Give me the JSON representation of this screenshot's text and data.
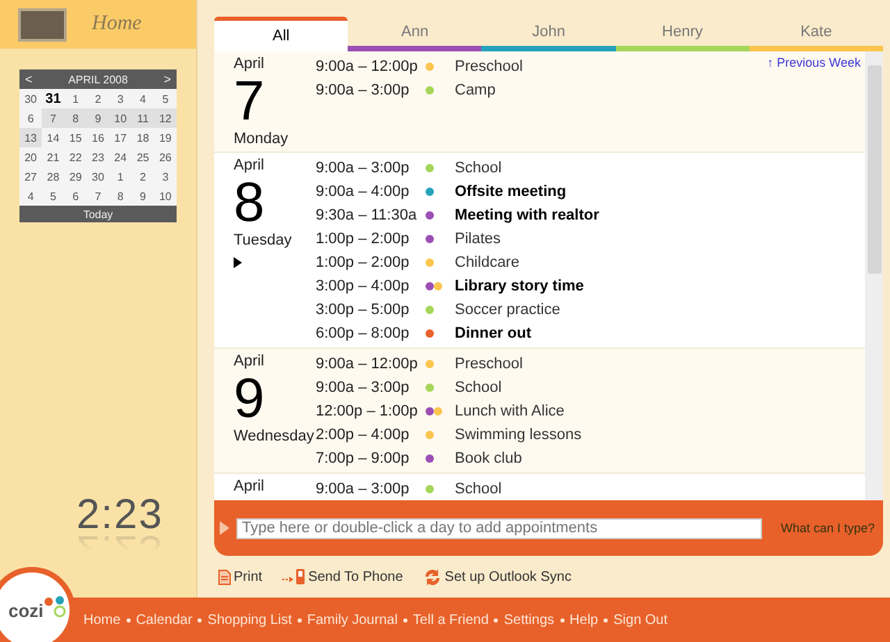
{
  "header": {
    "title": "Home"
  },
  "mini_calendar": {
    "prev": "<",
    "month": "APRIL 2008",
    "next": ">",
    "today_button": "Today",
    "weeks": [
      [
        {
          "label": "30",
          "selected": false,
          "today": false
        },
        {
          "label": "31",
          "selected": false,
          "today": true
        },
        {
          "label": "1",
          "selected": false,
          "today": false
        },
        {
          "label": "2",
          "selected": false,
          "today": false
        },
        {
          "label": "3",
          "selected": false,
          "today": false
        },
        {
          "label": "4",
          "selected": false,
          "today": false
        },
        {
          "label": "5",
          "selected": false,
          "today": false
        }
      ],
      [
        {
          "label": "6",
          "selected": false,
          "today": false
        },
        {
          "label": "7",
          "selected": true,
          "today": false
        },
        {
          "label": "8",
          "selected": true,
          "today": false
        },
        {
          "label": "9",
          "selected": true,
          "today": false
        },
        {
          "label": "10",
          "selected": true,
          "today": false
        },
        {
          "label": "11",
          "selected": true,
          "today": false
        },
        {
          "label": "12",
          "selected": true,
          "today": false
        }
      ],
      [
        {
          "label": "13",
          "selected": true,
          "today": false
        },
        {
          "label": "14",
          "selected": false,
          "today": false
        },
        {
          "label": "15",
          "selected": false,
          "today": false
        },
        {
          "label": "16",
          "selected": false,
          "today": false
        },
        {
          "label": "17",
          "selected": false,
          "today": false
        },
        {
          "label": "18",
          "selected": false,
          "today": false
        },
        {
          "label": "19",
          "selected": false,
          "today": false
        }
      ],
      [
        {
          "label": "20",
          "selected": false,
          "today": false
        },
        {
          "label": "21",
          "selected": false,
          "today": false
        },
        {
          "label": "22",
          "selected": false,
          "today": false
        },
        {
          "label": "23",
          "selected": false,
          "today": false
        },
        {
          "label": "24",
          "selected": false,
          "today": false
        },
        {
          "label": "25",
          "selected": false,
          "today": false
        },
        {
          "label": "26",
          "selected": false,
          "today": false
        }
      ],
      [
        {
          "label": "27",
          "selected": false,
          "today": false
        },
        {
          "label": "28",
          "selected": false,
          "today": false
        },
        {
          "label": "29",
          "selected": false,
          "today": false
        },
        {
          "label": "30",
          "selected": false,
          "today": false
        },
        {
          "label": "1",
          "selected": false,
          "today": false
        },
        {
          "label": "2",
          "selected": false,
          "today": false
        },
        {
          "label": "3",
          "selected": false,
          "today": false
        }
      ],
      [
        {
          "label": "4",
          "selected": false,
          "today": false
        },
        {
          "label": "5",
          "selected": false,
          "today": false
        },
        {
          "label": "6",
          "selected": false,
          "today": false
        },
        {
          "label": "7",
          "selected": false,
          "today": false
        },
        {
          "label": "8",
          "selected": false,
          "today": false
        },
        {
          "label": "9",
          "selected": false,
          "today": false
        },
        {
          "label": "10",
          "selected": false,
          "today": false
        }
      ]
    ]
  },
  "clock": "2:23",
  "tabs": [
    {
      "label": "All",
      "selected": true,
      "color": "#e8612a"
    },
    {
      "label": "Ann",
      "selected": false,
      "color": "#9b4fb5"
    },
    {
      "label": "John",
      "selected": false,
      "color": "#26a3bb"
    },
    {
      "label": "Henry",
      "selected": false,
      "color": "#a5d65a"
    },
    {
      "label": "Kate",
      "selected": false,
      "color": "#fbc54e"
    }
  ],
  "previous_week": "↑ Previous Week",
  "days": [
    {
      "month": "April",
      "date": "7",
      "weekday": "Monday",
      "current": false,
      "events": [
        {
          "time": "9:00a – 12:00p",
          "people": [
            {
              "color": "#fbc54e"
            }
          ],
          "title": "Preschool",
          "bold": false
        },
        {
          "time": "9:00a – 3:00p",
          "people": [
            {
              "color": "#a5d65a"
            }
          ],
          "title": "Camp",
          "bold": false
        }
      ]
    },
    {
      "month": "April",
      "date": "8",
      "weekday": "Tuesday",
      "current": true,
      "events": [
        {
          "time": "9:00a – 3:00p",
          "people": [
            {
              "color": "#a5d65a"
            }
          ],
          "title": "School",
          "bold": false
        },
        {
          "time": "9:00a – 4:00p",
          "people": [
            {
              "color": "#26a3bb"
            }
          ],
          "title": "Offsite meeting",
          "bold": true
        },
        {
          "time": "9:30a – 11:30a",
          "people": [
            {
              "color": "#9b4fb5"
            }
          ],
          "title": "Meeting with realtor",
          "bold": true
        },
        {
          "time": "1:00p – 2:00p",
          "people": [
            {
              "color": "#9b4fb5"
            }
          ],
          "title": "Pilates",
          "bold": false
        },
        {
          "time": "1:00p – 2:00p",
          "people": [
            {
              "color": "#fbc54e"
            }
          ],
          "title": "Childcare",
          "bold": false
        },
        {
          "time": "3:00p – 4:00p",
          "people": [
            {
              "color": "#9b4fb5"
            },
            {
              "color": "#fbc54e"
            }
          ],
          "title": "Library story time",
          "bold": true
        },
        {
          "time": "3:00p – 5:00p",
          "people": [
            {
              "color": "#a5d65a"
            }
          ],
          "title": "Soccer practice",
          "bold": false
        },
        {
          "time": "6:00p – 8:00p",
          "people": [
            {
              "color": "#e8612a"
            }
          ],
          "title": "Dinner out",
          "bold": true
        }
      ]
    },
    {
      "month": "April",
      "date": "9",
      "weekday": "Wednesday",
      "current": false,
      "events": [
        {
          "time": "9:00a – 12:00p",
          "people": [
            {
              "color": "#fbc54e"
            }
          ],
          "title": "Preschool",
          "bold": false
        },
        {
          "time": "9:00a – 3:00p",
          "people": [
            {
              "color": "#a5d65a"
            }
          ],
          "title": "School",
          "bold": false
        },
        {
          "time": "12:00p – 1:00p",
          "people": [
            {
              "color": "#9b4fb5"
            },
            {
              "color": "#fbc54e"
            }
          ],
          "title": "Lunch with Alice",
          "bold": false
        },
        {
          "time": "2:00p – 4:00p",
          "people": [
            {
              "color": "#fbc54e"
            }
          ],
          "title": "Swimming lessons",
          "bold": false
        },
        {
          "time": "7:00p – 9:00p",
          "people": [
            {
              "color": "#9b4fb5"
            }
          ],
          "title": "Book club",
          "bold": false
        }
      ]
    },
    {
      "month": "April",
      "current": false,
      "events": [
        {
          "time": "9:00a – 3:00p",
          "people": [
            {
              "color": "#a5d65a"
            }
          ],
          "title": "School",
          "bold": false
        }
      ]
    }
  ],
  "input": {
    "placeholder": "Type here or double-click a day to add appointments",
    "help_link": "What can I type?"
  },
  "actions": [
    {
      "label": "Print",
      "kind": "print"
    },
    {
      "label": "Send To Phone",
      "kind": "phone"
    },
    {
      "label": "Set up Outlook Sync",
      "kind": "sync"
    }
  ],
  "logo": "cozi",
  "nav": [
    "Home",
    "Calendar",
    "Shopping List",
    "Family Journal",
    "Tell a Friend",
    "Settings",
    "Help",
    "Sign Out"
  ]
}
